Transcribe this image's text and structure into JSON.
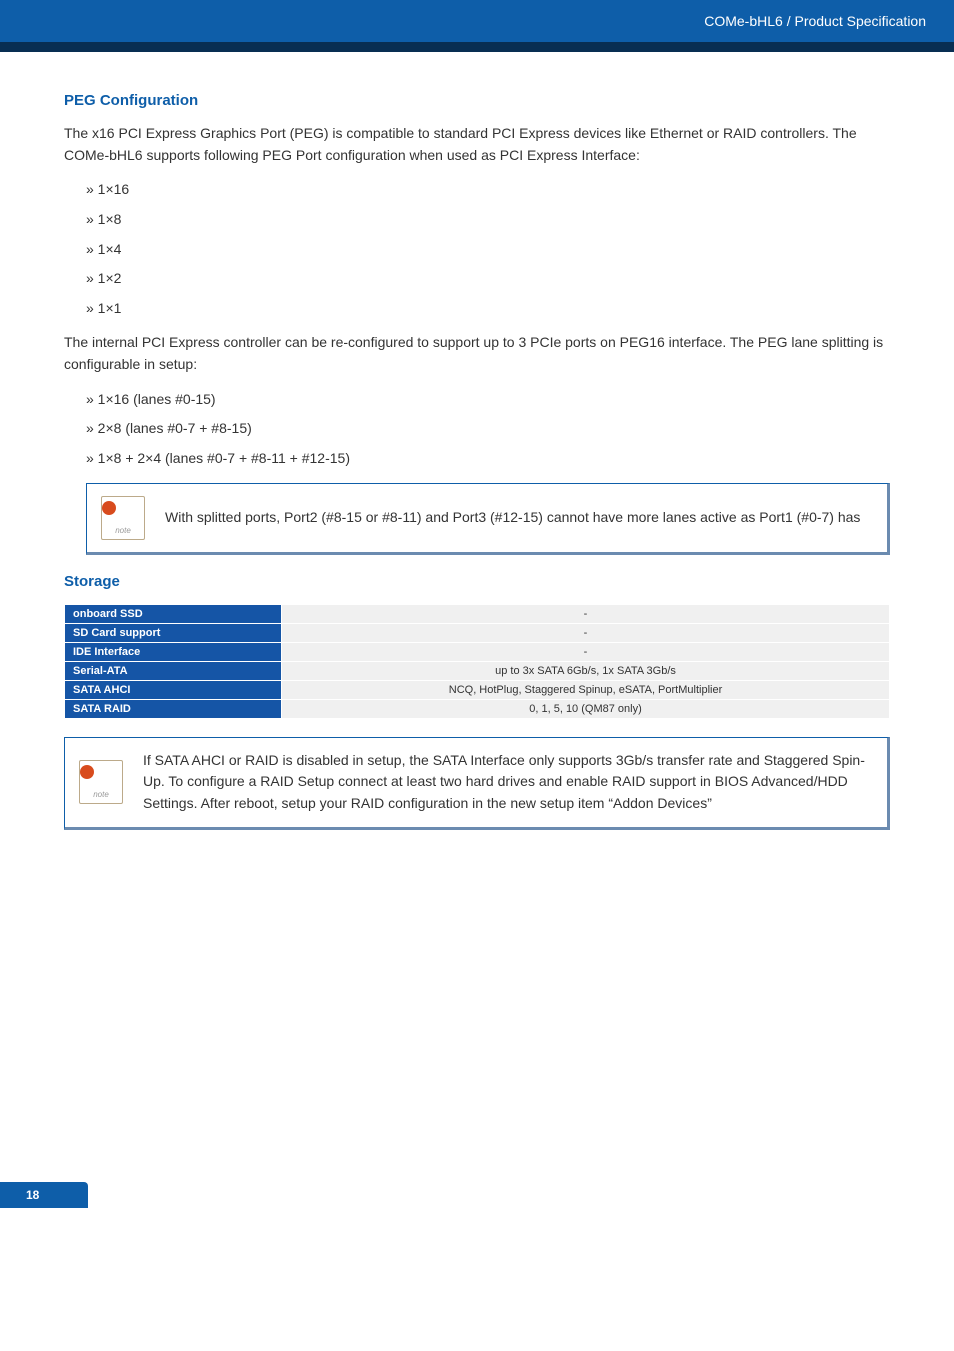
{
  "header": {
    "title": "COMe-bHL6 / Product Specification"
  },
  "sections": {
    "peg": {
      "title": "PEG Configuration",
      "para1": "The x16 PCI Express Graphics Port (PEG) is compatible to standard PCI Express devices like Ethernet or RAID controllers. The COMe-bHL6 supports following PEG Port configuration when used as PCI Express Interface:",
      "list1": [
        "» 1×16",
        "» 1×8",
        "» 1×4",
        "» 1×2",
        "» 1×1"
      ],
      "para2": "The internal PCI Express controller can be re-configured to support up to 3 PCIe ports on PEG16 interface. The PEG lane splitting is configurable in setup:",
      "list2": [
        "» 1×16 (lanes #0-15)",
        "» 2×8 (lanes #0-7 + #8-15)",
        "» 1×8 + 2×4 (lanes #0-7 + #8-11 + #12-15)"
      ],
      "note": "With splitted ports, Port2 (#8-15 or #8-11) and Port3 (#12-15) cannot have more lanes active as Port1 (#0-7) has"
    },
    "storage": {
      "title": "Storage",
      "rows": [
        {
          "label": "onboard SSD",
          "value": "-"
        },
        {
          "label": "SD Card support",
          "value": "-"
        },
        {
          "label": "IDE Interface",
          "value": "-"
        },
        {
          "label": "Serial-ATA",
          "value": "up to 3x SATA 6Gb/s, 1x SATA 3Gb/s"
        },
        {
          "label": "SATA AHCI",
          "value": "NCQ, HotPlug, Staggered Spinup, eSATA, PortMultiplier"
        },
        {
          "label": "SATA RAID",
          "value": "0, 1, 5, 10 (QM87 only)"
        }
      ],
      "note": "If SATA AHCI or RAID is disabled in setup, the SATA Interface only supports 3Gb/s transfer rate and Staggered Spin-Up. To configure a RAID Setup connect at least two hard drives and enable RAID support in BIOS Advanced/HDD Settings. After reboot, setup your RAID configuration in the new setup item “Addon Devices”"
    }
  },
  "footer": {
    "page": "18"
  }
}
